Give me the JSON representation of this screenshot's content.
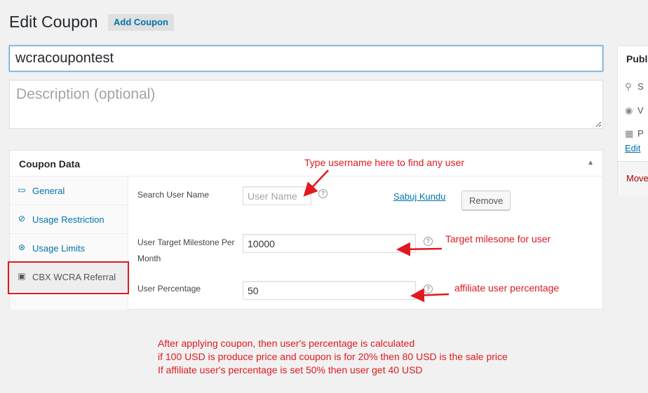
{
  "header": {
    "title": "Edit Coupon",
    "add_label": "Add Coupon"
  },
  "post": {
    "title_value": "wcracoupontest",
    "description_placeholder": "Description (optional)"
  },
  "publish": {
    "title": "Publ",
    "row1": "S",
    "row2": "V",
    "row3": "P",
    "edit": "Edit",
    "move": "Move"
  },
  "coupon_data": {
    "header": "Coupon Data",
    "tabs": [
      {
        "label": "General",
        "icon": "ticket-icon"
      },
      {
        "label": "Usage Restriction",
        "icon": "block-icon"
      },
      {
        "label": "Usage Limits",
        "icon": "limits-icon"
      },
      {
        "label": "CBX WCRA Referral",
        "icon": "window-icon"
      }
    ],
    "fields": {
      "search_label": "Search User Name",
      "search_placeholder": "User Name",
      "user_link": "Sabuj Kundu",
      "remove_label": "Remove",
      "milestone_label_line1": "User Target Milestone Per",
      "milestone_label_line2": "Month",
      "milestone_value": "10000",
      "percentage_label": "User Percentage",
      "percentage_value": "50"
    }
  },
  "annotations": {
    "username": "Type username here to find any user",
    "milestone": "Target milesone for user",
    "percentage": "affiliate user percentage",
    "note_line1": "After applying coupon, then user's percentage is calculated",
    "note_line2": "if 100 USD  is produce price and coupon is for 20% then 80 USD is the sale price",
    "note_line3": "If affiliate user's percentage is set 50% then user get 40 USD"
  },
  "colors": {
    "annotation": "#e0191f",
    "link": "#0073aa"
  }
}
